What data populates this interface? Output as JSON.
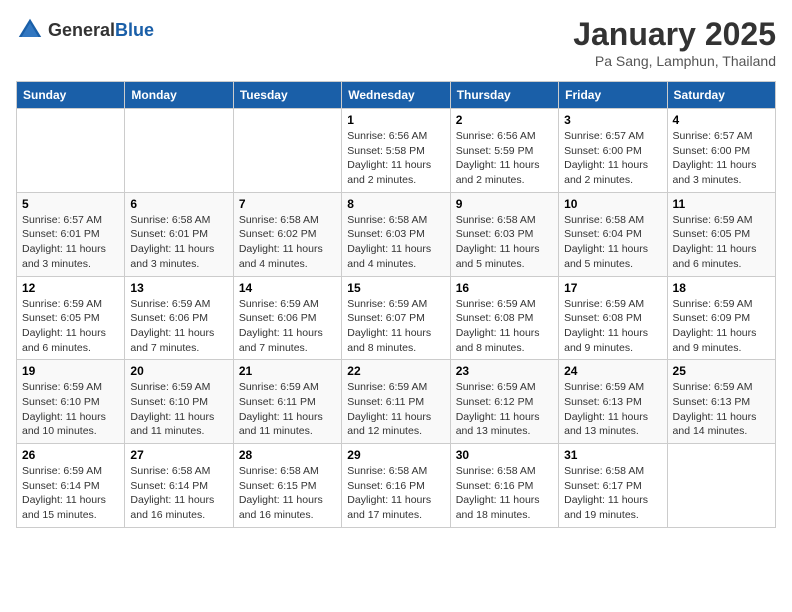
{
  "logo": {
    "general": "General",
    "blue": "Blue"
  },
  "header": {
    "month": "January 2025",
    "location": "Pa Sang, Lamphun, Thailand"
  },
  "weekdays": [
    "Sunday",
    "Monday",
    "Tuesday",
    "Wednesday",
    "Thursday",
    "Friday",
    "Saturday"
  ],
  "weeks": [
    [
      {
        "day": "",
        "sunrise": "",
        "sunset": "",
        "daylight": ""
      },
      {
        "day": "",
        "sunrise": "",
        "sunset": "",
        "daylight": ""
      },
      {
        "day": "",
        "sunrise": "",
        "sunset": "",
        "daylight": ""
      },
      {
        "day": "1",
        "sunrise": "Sunrise: 6:56 AM",
        "sunset": "Sunset: 5:58 PM",
        "daylight": "Daylight: 11 hours and 2 minutes."
      },
      {
        "day": "2",
        "sunrise": "Sunrise: 6:56 AM",
        "sunset": "Sunset: 5:59 PM",
        "daylight": "Daylight: 11 hours and 2 minutes."
      },
      {
        "day": "3",
        "sunrise": "Sunrise: 6:57 AM",
        "sunset": "Sunset: 6:00 PM",
        "daylight": "Daylight: 11 hours and 2 minutes."
      },
      {
        "day": "4",
        "sunrise": "Sunrise: 6:57 AM",
        "sunset": "Sunset: 6:00 PM",
        "daylight": "Daylight: 11 hours and 3 minutes."
      }
    ],
    [
      {
        "day": "5",
        "sunrise": "Sunrise: 6:57 AM",
        "sunset": "Sunset: 6:01 PM",
        "daylight": "Daylight: 11 hours and 3 minutes."
      },
      {
        "day": "6",
        "sunrise": "Sunrise: 6:58 AM",
        "sunset": "Sunset: 6:01 PM",
        "daylight": "Daylight: 11 hours and 3 minutes."
      },
      {
        "day": "7",
        "sunrise": "Sunrise: 6:58 AM",
        "sunset": "Sunset: 6:02 PM",
        "daylight": "Daylight: 11 hours and 4 minutes."
      },
      {
        "day": "8",
        "sunrise": "Sunrise: 6:58 AM",
        "sunset": "Sunset: 6:03 PM",
        "daylight": "Daylight: 11 hours and 4 minutes."
      },
      {
        "day": "9",
        "sunrise": "Sunrise: 6:58 AM",
        "sunset": "Sunset: 6:03 PM",
        "daylight": "Daylight: 11 hours and 5 minutes."
      },
      {
        "day": "10",
        "sunrise": "Sunrise: 6:58 AM",
        "sunset": "Sunset: 6:04 PM",
        "daylight": "Daylight: 11 hours and 5 minutes."
      },
      {
        "day": "11",
        "sunrise": "Sunrise: 6:59 AM",
        "sunset": "Sunset: 6:05 PM",
        "daylight": "Daylight: 11 hours and 6 minutes."
      }
    ],
    [
      {
        "day": "12",
        "sunrise": "Sunrise: 6:59 AM",
        "sunset": "Sunset: 6:05 PM",
        "daylight": "Daylight: 11 hours and 6 minutes."
      },
      {
        "day": "13",
        "sunrise": "Sunrise: 6:59 AM",
        "sunset": "Sunset: 6:06 PM",
        "daylight": "Daylight: 11 hours and 7 minutes."
      },
      {
        "day": "14",
        "sunrise": "Sunrise: 6:59 AM",
        "sunset": "Sunset: 6:06 PM",
        "daylight": "Daylight: 11 hours and 7 minutes."
      },
      {
        "day": "15",
        "sunrise": "Sunrise: 6:59 AM",
        "sunset": "Sunset: 6:07 PM",
        "daylight": "Daylight: 11 hours and 8 minutes."
      },
      {
        "day": "16",
        "sunrise": "Sunrise: 6:59 AM",
        "sunset": "Sunset: 6:08 PM",
        "daylight": "Daylight: 11 hours and 8 minutes."
      },
      {
        "day": "17",
        "sunrise": "Sunrise: 6:59 AM",
        "sunset": "Sunset: 6:08 PM",
        "daylight": "Daylight: 11 hours and 9 minutes."
      },
      {
        "day": "18",
        "sunrise": "Sunrise: 6:59 AM",
        "sunset": "Sunset: 6:09 PM",
        "daylight": "Daylight: 11 hours and 9 minutes."
      }
    ],
    [
      {
        "day": "19",
        "sunrise": "Sunrise: 6:59 AM",
        "sunset": "Sunset: 6:10 PM",
        "daylight": "Daylight: 11 hours and 10 minutes."
      },
      {
        "day": "20",
        "sunrise": "Sunrise: 6:59 AM",
        "sunset": "Sunset: 6:10 PM",
        "daylight": "Daylight: 11 hours and 11 minutes."
      },
      {
        "day": "21",
        "sunrise": "Sunrise: 6:59 AM",
        "sunset": "Sunset: 6:11 PM",
        "daylight": "Daylight: 11 hours and 11 minutes."
      },
      {
        "day": "22",
        "sunrise": "Sunrise: 6:59 AM",
        "sunset": "Sunset: 6:11 PM",
        "daylight": "Daylight: 11 hours and 12 minutes."
      },
      {
        "day": "23",
        "sunrise": "Sunrise: 6:59 AM",
        "sunset": "Sunset: 6:12 PM",
        "daylight": "Daylight: 11 hours and 13 minutes."
      },
      {
        "day": "24",
        "sunrise": "Sunrise: 6:59 AM",
        "sunset": "Sunset: 6:13 PM",
        "daylight": "Daylight: 11 hours and 13 minutes."
      },
      {
        "day": "25",
        "sunrise": "Sunrise: 6:59 AM",
        "sunset": "Sunset: 6:13 PM",
        "daylight": "Daylight: 11 hours and 14 minutes."
      }
    ],
    [
      {
        "day": "26",
        "sunrise": "Sunrise: 6:59 AM",
        "sunset": "Sunset: 6:14 PM",
        "daylight": "Daylight: 11 hours and 15 minutes."
      },
      {
        "day": "27",
        "sunrise": "Sunrise: 6:58 AM",
        "sunset": "Sunset: 6:14 PM",
        "daylight": "Daylight: 11 hours and 16 minutes."
      },
      {
        "day": "28",
        "sunrise": "Sunrise: 6:58 AM",
        "sunset": "Sunset: 6:15 PM",
        "daylight": "Daylight: 11 hours and 16 minutes."
      },
      {
        "day": "29",
        "sunrise": "Sunrise: 6:58 AM",
        "sunset": "Sunset: 6:16 PM",
        "daylight": "Daylight: 11 hours and 17 minutes."
      },
      {
        "day": "30",
        "sunrise": "Sunrise: 6:58 AM",
        "sunset": "Sunset: 6:16 PM",
        "daylight": "Daylight: 11 hours and 18 minutes."
      },
      {
        "day": "31",
        "sunrise": "Sunrise: 6:58 AM",
        "sunset": "Sunset: 6:17 PM",
        "daylight": "Daylight: 11 hours and 19 minutes."
      },
      {
        "day": "",
        "sunrise": "",
        "sunset": "",
        "daylight": ""
      }
    ]
  ]
}
